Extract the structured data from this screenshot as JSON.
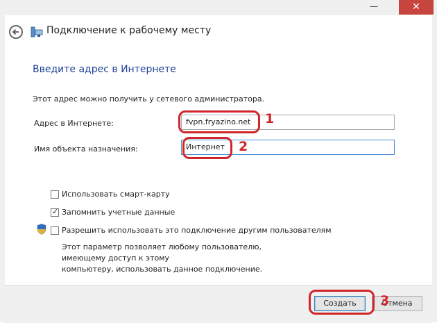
{
  "window": {
    "minimize_glyph": "—",
    "close_glyph": "✕",
    "title": "Подключение к рабочему месту"
  },
  "form": {
    "heading": "Введите адрес в Интернете",
    "hint": "Этот адрес можно получить у сетевого администратора.",
    "address_label": "Адрес в Интернете:",
    "address_value": "fvpn.fryazino.net",
    "dest_label": "Имя объекта назначения:",
    "dest_value": "Интернет"
  },
  "options": {
    "smartcard": {
      "label": "Использовать смарт-карту",
      "checked": false
    },
    "remember": {
      "label": "Запомнить учетные данные",
      "checked": true
    },
    "share": {
      "label": "Разрешить использовать это подключение другим пользователям",
      "checked": false
    },
    "share_desc_line1": "Этот параметр позволяет любому пользователю, имеющему доступ к этому",
    "share_desc_line2": "компьютеру, использовать данное подключение."
  },
  "footer": {
    "create_label": "Создать",
    "cancel_label": "Отмена"
  },
  "annotations": {
    "n1": "1",
    "n2": "2",
    "n3": "3",
    "color": "#d0262b"
  },
  "icons": {
    "back": "back-arrow-icon",
    "app": "network-connection-icon",
    "shield": "uac-shield-icon"
  }
}
